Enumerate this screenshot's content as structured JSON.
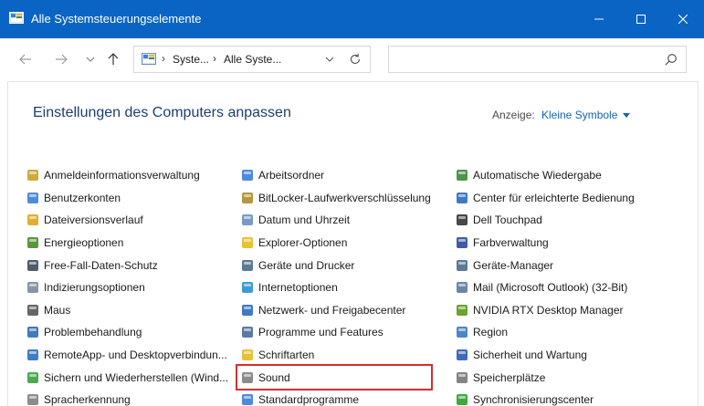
{
  "window": {
    "title": "Alle Systemsteuerungselemente",
    "titlebar_color": "#0a64c4"
  },
  "navigation": {
    "back_icon": "arrow-left-icon",
    "forward_icon": "arrow-right-icon",
    "recent_icon": "chevron-down-icon",
    "up_icon": "arrow-up-icon",
    "breadcrumbs": [
      "Syste...",
      "Alle Syste..."
    ],
    "search_placeholder": ""
  },
  "main": {
    "heading": "Einstellungen des Computers anpassen",
    "view_label": "Anzeige:",
    "view_value": "Kleine Symbole",
    "accent_color": "#1063b8",
    "highlight_color": "#d32f2f"
  },
  "columns": [
    {
      "items": [
        {
          "label": "Anmeldeinformationsverwaltung",
          "icon": "credential-manager-icon",
          "color": "#c9a227"
        },
        {
          "label": "Benutzerkonten",
          "icon": "user-accounts-icon",
          "color": "#3b7dd8"
        },
        {
          "label": "Dateiversionsverlauf",
          "icon": "file-history-icon",
          "color": "#e0a51b"
        },
        {
          "label": "Energieoptionen",
          "icon": "power-options-icon",
          "color": "#4a8a2a"
        },
        {
          "label": "Free-Fall-Daten-Schutz",
          "icon": "free-fall-icon",
          "color": "#3c4a5a"
        },
        {
          "label": "Indizierungsoptionen",
          "icon": "indexing-icon",
          "color": "#7a8aa0"
        },
        {
          "label": "Maus",
          "icon": "mouse-icon",
          "color": "#555555"
        },
        {
          "label": "Problembehandlung",
          "icon": "troubleshooting-icon",
          "color": "#2f6db5"
        },
        {
          "label": "RemoteApp- und Desktopverbindun...",
          "icon": "remoteapp-icon",
          "color": "#2c6fbf"
        },
        {
          "label": "Sichern und Wiederherstellen (Wind...",
          "icon": "backup-icon",
          "color": "#3aa03a"
        },
        {
          "label": "Spracherkennung",
          "icon": "microphone-icon",
          "color": "#808080"
        }
      ]
    },
    {
      "items": [
        {
          "label": "Arbeitsordner",
          "icon": "work-folders-icon",
          "color": "#3b7dd8"
        },
        {
          "label": "BitLocker-Laufwerkverschlüsselung",
          "icon": "bitlocker-icon",
          "color": "#b08a2a"
        },
        {
          "label": "Datum und Uhrzeit",
          "icon": "clock-icon",
          "color": "#6a8fc0"
        },
        {
          "label": "Explorer-Optionen",
          "icon": "folder-options-icon",
          "color": "#e8b923"
        },
        {
          "label": "Geräte und Drucker",
          "icon": "devices-printers-icon",
          "color": "#4a6a8a"
        },
        {
          "label": "Internetoptionen",
          "icon": "internet-options-icon",
          "color": "#2a8fd0"
        },
        {
          "label": "Netzwerk- und Freigabecenter",
          "icon": "network-icon",
          "color": "#2a6ac0"
        },
        {
          "label": "Programme und Features",
          "icon": "programs-icon",
          "color": "#4a6a9a"
        },
        {
          "label": "Schriftarten",
          "icon": "fonts-icon",
          "color": "#e8b923"
        },
        {
          "label": "Sound",
          "icon": "speaker-icon",
          "color": "#808080",
          "highlight": true
        },
        {
          "label": "Standardprogramme",
          "icon": "default-programs-icon",
          "color": "#3b7dd8"
        }
      ]
    },
    {
      "items": [
        {
          "label": "Automatische Wiedergabe",
          "icon": "autoplay-icon",
          "color": "#3a8a3a"
        },
        {
          "label": "Center für erleichterte Bedienung",
          "icon": "ease-of-access-icon",
          "color": "#2a6ac0"
        },
        {
          "label": "Dell Touchpad",
          "icon": "touchpad-icon",
          "color": "#333333"
        },
        {
          "label": "Farbverwaltung",
          "icon": "color-management-icon",
          "color": "#2a4a9a"
        },
        {
          "label": "Geräte-Manager",
          "icon": "device-manager-icon",
          "color": "#4a6a8a"
        },
        {
          "label": "Mail (Microsoft Outlook) (32-Bit)",
          "icon": "mail-icon",
          "color": "#5a7aa0"
        },
        {
          "label": "NVIDIA RTX Desktop Manager",
          "icon": "nvidia-icon",
          "color": "#5a9a1a"
        },
        {
          "label": "Region",
          "icon": "region-icon",
          "color": "#3a7ac0"
        },
        {
          "label": "Sicherheit und Wartung",
          "icon": "flag-icon",
          "color": "#2a5ab0"
        },
        {
          "label": "Speicherplätze",
          "icon": "storage-spaces-icon",
          "color": "#777777"
        },
        {
          "label": "Synchronisierungscenter",
          "icon": "sync-center-icon",
          "color": "#2aa02a"
        }
      ]
    }
  ]
}
